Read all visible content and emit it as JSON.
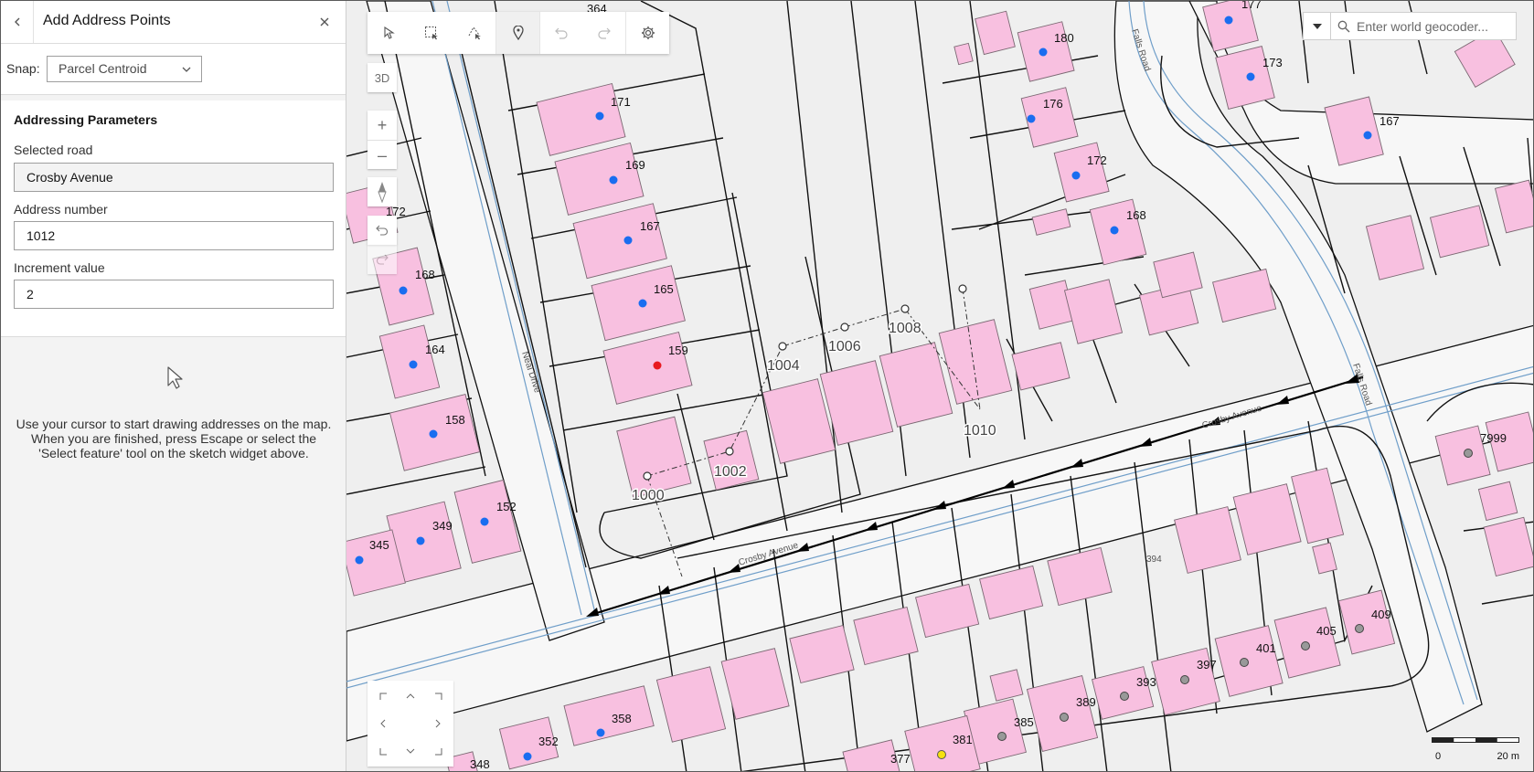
{
  "panel": {
    "title": "Add Address Points",
    "snap_label": "Snap:",
    "snap_value": "Parcel Centroid",
    "section_title": "Addressing Parameters",
    "road_label": "Selected road",
    "road_value": "Crosby Avenue",
    "number_label": "Address number",
    "number_value": "1012",
    "increment_label": "Increment value",
    "increment_value": "2",
    "hint_lines": [
      "Use your cursor to start drawing addresses on the map.",
      "When you are finished, press Escape or select the",
      "'Select feature' tool on the sketch widget above."
    ]
  },
  "map_controls": {
    "view_3d": "3D",
    "zoom_in": "+",
    "zoom_out": "–"
  },
  "search": {
    "placeholder": "Enter world geocoder..."
  },
  "scale": {
    "start": "0",
    "end": "20 m"
  },
  "map_labels": {
    "numbers": [
      "364",
      "177",
      "180",
      "176",
      "172",
      "173",
      "167",
      "171",
      "169",
      "167",
      "165",
      "159",
      "172",
      "168",
      "164",
      "158",
      "152",
      "349",
      "345",
      "168",
      "7999",
      "409",
      "405",
      "401",
      "397",
      "393",
      "389",
      "385",
      "381",
      "377",
      "358",
      "352",
      "348",
      "394"
    ],
    "addresses": [
      "1000",
      "1002",
      "1004",
      "1006",
      "1008",
      "1010"
    ],
    "roads": [
      "Crosby Avenue",
      "Crosby Avenue",
      "Falls Road",
      "Falls Road",
      "Neal Drive"
    ]
  },
  "colors": {
    "building": "#f8c0e0",
    "address_point": "#1a6df0",
    "selected_point": "#e8191f",
    "highlight_point": "#f5e10f",
    "water": "#6f9ec9"
  }
}
